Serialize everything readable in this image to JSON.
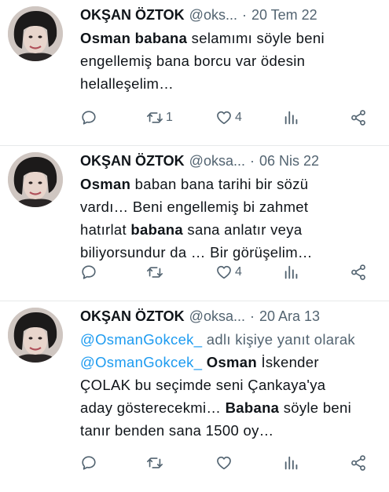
{
  "tweets": [
    {
      "author": "OKŞAN ÖZTOK",
      "handle": "@oks...",
      "dot": "·",
      "date": "20 Tem 22",
      "lines": [
        [
          {
            "t": "Osman babana",
            "b": true
          },
          {
            "t": " selamımı söyle beni"
          }
        ],
        [
          {
            "t": "engellemiş bana borcu var ödesin"
          }
        ],
        [
          {
            "t": "helalleşelim…"
          }
        ]
      ],
      "retweets": "1",
      "likes": "4"
    },
    {
      "author": "OKŞAN ÖZTOK",
      "handle": "@oksa...",
      "dot": "·",
      "date": "06 Nis 22",
      "lines": [
        [
          {
            "t": "Osman",
            "b": true
          },
          {
            "t": " baban bana tarihi bir sözü"
          }
        ],
        [
          {
            "t": "vardı… Beni engellemiş bi zahmet"
          }
        ],
        [
          {
            "t": "hatırlat "
          },
          {
            "t": "babana",
            "b": true
          },
          {
            "t": " sana anlatır veya"
          }
        ],
        [
          {
            "t": "biliyorsundur da … Bir görüşelim…"
          }
        ]
      ],
      "retweets": "",
      "likes": "4"
    },
    {
      "author": "OKŞAN ÖZTOK",
      "handle": "@oksa...",
      "dot": "·",
      "date": "20 Ara 13",
      "lines": [
        [
          {
            "t": "@OsmanGokcek_",
            "m": true
          },
          {
            "t": " adlı kişiye yanıt olarak",
            "r": true
          }
        ],
        [
          {
            "t": "@OsmanGokcek_",
            "m": true
          },
          {
            "t": " "
          },
          {
            "t": "Osman",
            "b": true
          },
          {
            "t": " İskender"
          }
        ],
        [
          {
            "t": "ÇOLAK bu seçimde seni Çankaya'ya"
          }
        ],
        [
          {
            "t": "aday gösterecekmi… "
          },
          {
            "t": "Babana",
            "b": true
          },
          {
            "t": " söyle beni"
          }
        ],
        [
          {
            "t": "tanır benden sana 1500 oy…"
          }
        ]
      ],
      "retweets": "",
      "likes": ""
    }
  ],
  "icons": {
    "reply": "reply-icon",
    "retweet": "retweet-icon",
    "like": "heart-icon",
    "views": "views-icon",
    "share": "share-icon"
  },
  "colors": {
    "text": "#0f1419",
    "secondary": "#536471",
    "link": "#1d9bf0",
    "divider": "#e7e9ea"
  }
}
